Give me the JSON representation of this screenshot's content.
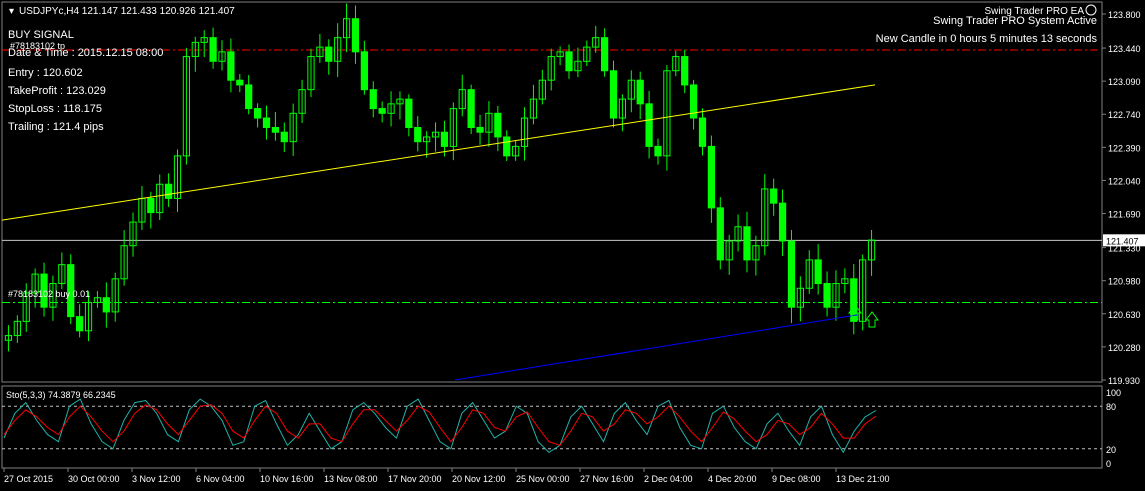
{
  "header": {
    "symbol_line": "USDJPYc,H4  121.147 121.433 120.926 121.407",
    "ea_title": "Swing Trader PRO EA",
    "ea_status": "Swing Trader PRO System Active",
    "new_candle": "New Candle in 0 hours 5 minutes 13 seconds",
    "smiley_icon": "smiley-icon"
  },
  "signal_panel": {
    "lines": [
      "BUY SIGNAL",
      "Date & Time : 2015.12.15 08:00",
      "Entry : 120.602",
      "TakeProfit : 123.029",
      "StopLoss : 118.175",
      "Trailing : 121.4 pips"
    ],
    "tp_order_label": "#78183102 tp",
    "buy_order_label": "#78183102 buy 0.01"
  },
  "price_axis": {
    "ticks": [
      "123.800",
      "123.440",
      "123.090",
      "122.740",
      "122.390",
      "122.040",
      "121.690",
      "121.330",
      "120.980",
      "120.630",
      "120.280",
      "119.930"
    ],
    "current_price_label": "121.407",
    "range": [
      119.93,
      123.8
    ]
  },
  "time_axis": {
    "ticks": [
      "27 Oct 2015",
      "30 Oct 00:00",
      "3 Nov 12:00",
      "6 Nov 04:00",
      "10 Nov 16:00",
      "13 Nov 08:00",
      "17 Nov 20:00",
      "20 Nov 12:00",
      "25 Nov 00:00",
      "27 Nov 16:00",
      "2 Dec 04:00",
      "4 Dec 20:00",
      "9 Dec 08:00",
      "13 Dec 21:00"
    ]
  },
  "oscillator": {
    "label": "Sto(5,3,3) 74.3879 66.2345",
    "ticks": [
      "100",
      "80",
      "20",
      "0"
    ],
    "range": [
      0,
      100
    ]
  },
  "colors": {
    "background": "#000000",
    "candle": "#00ff00",
    "tp_line": "#ff0000",
    "buy_line": "#00ff00",
    "trend_upper": "#ffff00",
    "trend_lower": "#0000ff",
    "current_price": "#c8c8c8",
    "stoch_main": "#20b2aa",
    "stoch_signal": "#ff0000",
    "text": "#ffffff"
  },
  "chart_data": {
    "type": "candlestick",
    "symbol": "USDJPYc",
    "timeframe": "H4",
    "last_bar": {
      "open": 121.147,
      "high": 121.433,
      "low": 120.926,
      "close": 121.407
    },
    "levels": {
      "take_profit": 123.029,
      "entry": 120.602,
      "tp_line_price": 123.42,
      "buy_line_price": 120.75,
      "current_price": 121.407
    },
    "close_trace": [
      120.4,
      120.55,
      120.85,
      121.05,
      120.7,
      120.95,
      121.15,
      120.6,
      120.45,
      120.75,
      120.8,
      120.65,
      121.0,
      121.35,
      121.6,
      121.85,
      121.7,
      122.0,
      121.85,
      122.3,
      123.35,
      123.5,
      123.55,
      123.3,
      123.4,
      123.1,
      123.05,
      122.8,
      122.7,
      122.6,
      122.55,
      122.45,
      122.75,
      123.0,
      123.35,
      123.45,
      123.3,
      123.55,
      123.75,
      123.4,
      123.0,
      122.8,
      122.75,
      122.85,
      122.9,
      122.6,
      122.45,
      122.5,
      122.55,
      122.4,
      122.8,
      123.0,
      122.6,
      122.55,
      122.75,
      122.5,
      122.3,
      122.4,
      122.7,
      122.9,
      123.1,
      123.35,
      123.4,
      123.2,
      123.3,
      123.45,
      123.55,
      123.2,
      122.7,
      122.9,
      123.1,
      122.85,
      122.4,
      122.3,
      123.2,
      123.35,
      123.05,
      122.7,
      122.4,
      121.75,
      121.2,
      121.4,
      121.55,
      121.2,
      121.35,
      121.95,
      121.8,
      121.4,
      120.7,
      120.9,
      121.2,
      120.95,
      120.7,
      120.95,
      121.0,
      120.55,
      121.2,
      121.41
    ],
    "stochastic": {
      "main": [
        35,
        70,
        85,
        60,
        40,
        30,
        80,
        90,
        55,
        30,
        20,
        60,
        85,
        88,
        70,
        40,
        30,
        75,
        90,
        80,
        60,
        25,
        30,
        80,
        88,
        55,
        25,
        40,
        70,
        45,
        20,
        30,
        75,
        85,
        70,
        50,
        35,
        80,
        90,
        60,
        30,
        20,
        70,
        85,
        60,
        35,
        45,
        80,
        70,
        30,
        15,
        25,
        65,
        80,
        55,
        30,
        70,
        85,
        60,
        40,
        80,
        88,
        50,
        25,
        20,
        70,
        80,
        50,
        30,
        20,
        55,
        70,
        45,
        25,
        65,
        80,
        40,
        15,
        45,
        65,
        74
      ],
      "signal": [
        40,
        60,
        75,
        65,
        50,
        40,
        65,
        80,
        65,
        45,
        30,
        45,
        70,
        82,
        75,
        55,
        40,
        60,
        80,
        82,
        70,
        45,
        35,
        60,
        80,
        70,
        45,
        35,
        55,
        55,
        35,
        30,
        55,
        75,
        75,
        60,
        45,
        60,
        80,
        72,
        50,
        30,
        50,
        75,
        70,
        50,
        45,
        65,
        72,
        50,
        30,
        25,
        45,
        70,
        65,
        45,
        55,
        75,
        70,
        55,
        65,
        80,
        65,
        45,
        30,
        50,
        72,
        62,
        45,
        30,
        40,
        60,
        55,
        40,
        50,
        70,
        55,
        35,
        35,
        55,
        66
      ]
    }
  }
}
